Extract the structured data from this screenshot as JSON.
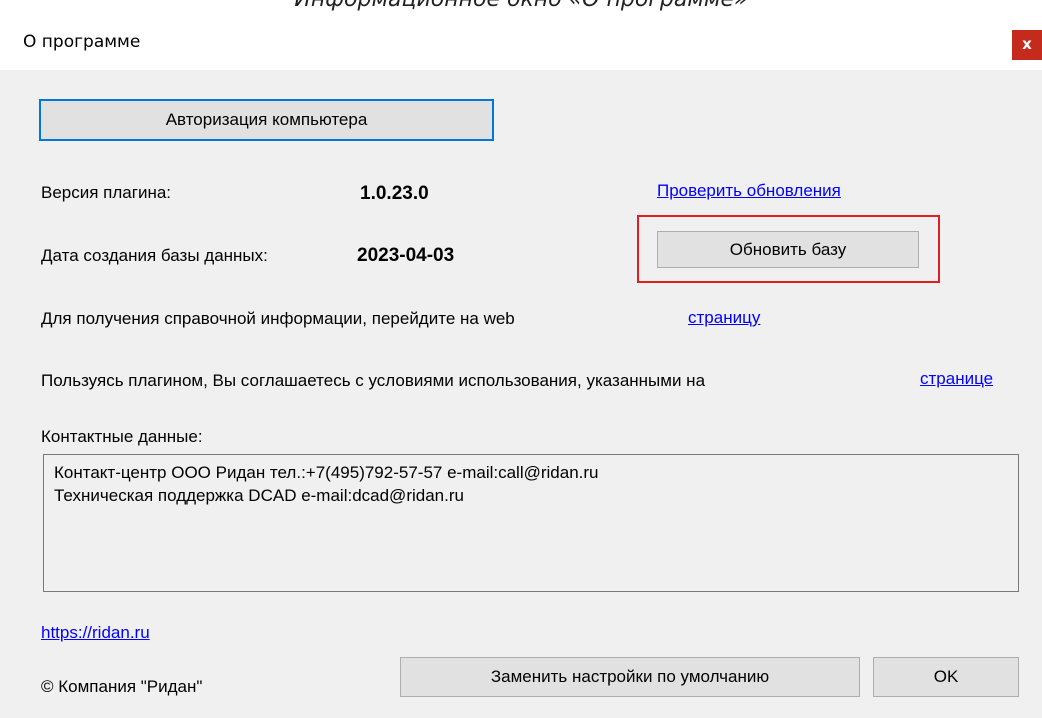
{
  "caption": "Информационное окно «О программе»",
  "window": {
    "title": "О программе",
    "close_glyph": "x"
  },
  "authorize_button": "Авторизация компьютера",
  "plugin_version": {
    "label": "Версия плагина:",
    "value": "1.0.23.0"
  },
  "check_updates_link": "Проверить обновления",
  "db_date": {
    "label": "Дата создания базы данных:",
    "value": "2023-04-03"
  },
  "update_db_button": "Обновить базу",
  "help_line": {
    "text": "Для получения справочной информации, перейдите на web",
    "link": "страницу"
  },
  "terms_line": {
    "text": "Пользуясь плагином, Вы соглашаетесь с условиями использования, указанными на",
    "link": "странице"
  },
  "contacts": {
    "label": "Контактные данные:",
    "lines": [
      "Контакт-центр ООО Ридан тел.:+7(495)792-57-57 e-mail:call@ridan.ru",
      "Техническая поддержка DCAD e-mail:dcad@ridan.ru"
    ]
  },
  "site_link": "https://ridan.ru",
  "copyright": "© Компания \"Ридан\"",
  "reset_settings_button": "Заменить настройки по умолчанию",
  "ok_button": "OK",
  "colors": {
    "highlight": "#e02020",
    "link": "#0000ff",
    "focus_border": "#0078d7",
    "close_button": "#c42b1c"
  }
}
